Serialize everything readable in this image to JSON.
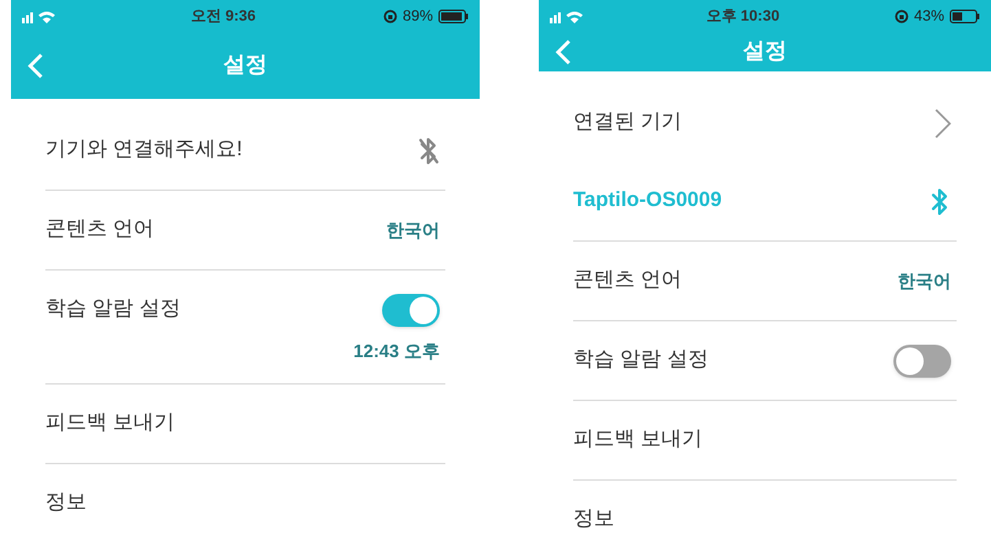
{
  "screens": [
    {
      "status_bar": {
        "time": "오전 9:36",
        "battery": "89%"
      },
      "title": "설정",
      "rows": [
        {
          "kind": "device",
          "label": "기기와 연결해주세요!",
          "connected": false
        },
        {
          "kind": "value",
          "label": "콘텐츠 언어",
          "value": "한국어"
        },
        {
          "kind": "toggle",
          "label": "학습 알람 설정",
          "on": true,
          "time": "12:43 오후"
        },
        {
          "kind": "plain",
          "label": "피드백 보내기"
        },
        {
          "kind": "plain",
          "label": "정보"
        }
      ]
    },
    {
      "status_bar": {
        "time": "오후 10:30",
        "battery": "43%"
      },
      "title": "설정",
      "rows": [
        {
          "kind": "link",
          "label": "연결된 기기"
        },
        {
          "kind": "device",
          "label": "Taptilo-OS0009",
          "connected": true
        },
        {
          "kind": "value",
          "label": "콘텐츠 언어",
          "value": "한국어"
        },
        {
          "kind": "toggle",
          "label": "학습 알람 설정",
          "on": false
        },
        {
          "kind": "plain",
          "label": "피드백 보내기"
        },
        {
          "kind": "plain",
          "label": "정보"
        }
      ]
    }
  ]
}
